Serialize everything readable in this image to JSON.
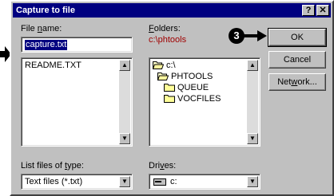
{
  "title": "Capture to file",
  "titlebar_buttons": {
    "help": "?",
    "close": "✕"
  },
  "file_name": {
    "label_pre": "File ",
    "label_u": "n",
    "label_post": "ame:",
    "value": "capture.txt"
  },
  "file_list": [
    "README.TXT"
  ],
  "folders": {
    "label_u": "F",
    "label_post": "olders:",
    "path": "c:\\phtools",
    "path_color": "#a00000",
    "tree": [
      "c:\\",
      "PHTOOLS",
      "QUEUE",
      "VOCFILES"
    ]
  },
  "list_type": {
    "label_pre": "List files of ",
    "label_u": "t",
    "label_post": "ype:",
    "value": "Text files (*.txt)"
  },
  "drives": {
    "label_pre": "Dri",
    "label_u": "v",
    "label_post": "es:",
    "value": "c:"
  },
  "buttons": {
    "ok": "OK",
    "cancel": "Cancel",
    "network_pre": "Net",
    "network_u": "w",
    "network_post": "ork..."
  },
  "callout": {
    "number": "3"
  },
  "icons": [
    "open-folder-icon",
    "folder-icon",
    "drive-icon",
    "pointer-arrow-icon",
    "callout-badge-icon"
  ]
}
